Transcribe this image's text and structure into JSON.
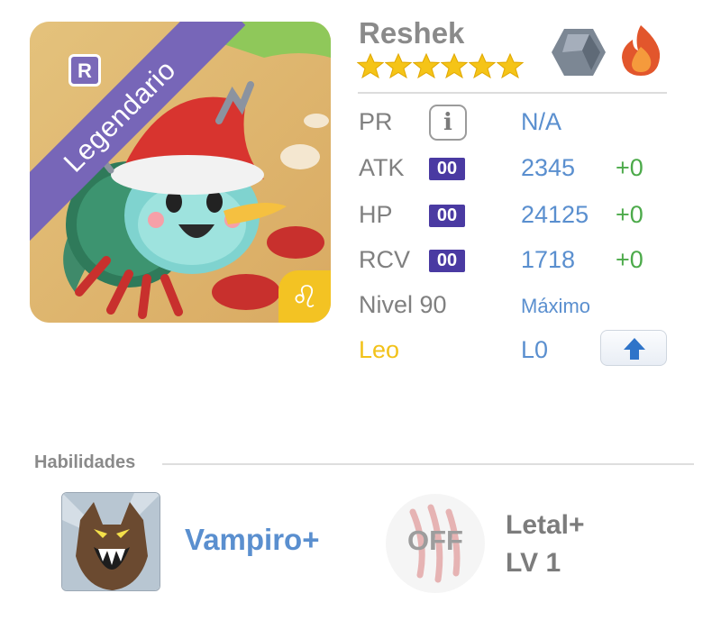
{
  "monster": {
    "name": "Reshek",
    "rarity": "Legendario",
    "rarity_letter": "R",
    "zodiac_symbol": "♌",
    "stars": 6,
    "elements": [
      "earth",
      "fire"
    ]
  },
  "stats": {
    "pr": {
      "label": "PR",
      "value": "N/A",
      "icon": "info-icon",
      "icon_text": "i"
    },
    "atk": {
      "label": "ATK",
      "plus": "00",
      "value": "2345",
      "bonus": "+0"
    },
    "hp": {
      "label": "HP",
      "plus": "00",
      "value": "24125",
      "bonus": "+0"
    },
    "rcv": {
      "label": "RCV",
      "plus": "00",
      "value": "1718",
      "bonus": "+0"
    },
    "level": {
      "label": "Nivel 90",
      "status": "Máximo"
    },
    "zodiac": {
      "label": "Leo",
      "code": "L0"
    }
  },
  "skills": {
    "section_title": "Habilidades",
    "items": [
      {
        "name": "Vampiro+",
        "icon": "werewolf-icon"
      },
      {
        "name": "Letal+",
        "level": "LV 1",
        "state": "OFF",
        "icon": "claw-marks-icon"
      }
    ]
  },
  "colors": {
    "purple_banner": "#7766b8",
    "plus_badge": "#4a3aa2",
    "value_blue": "#5a8fcf",
    "bonus_green": "#4caa4a",
    "zodiac_yellow": "#f2c21a",
    "star": "#f5c417"
  }
}
